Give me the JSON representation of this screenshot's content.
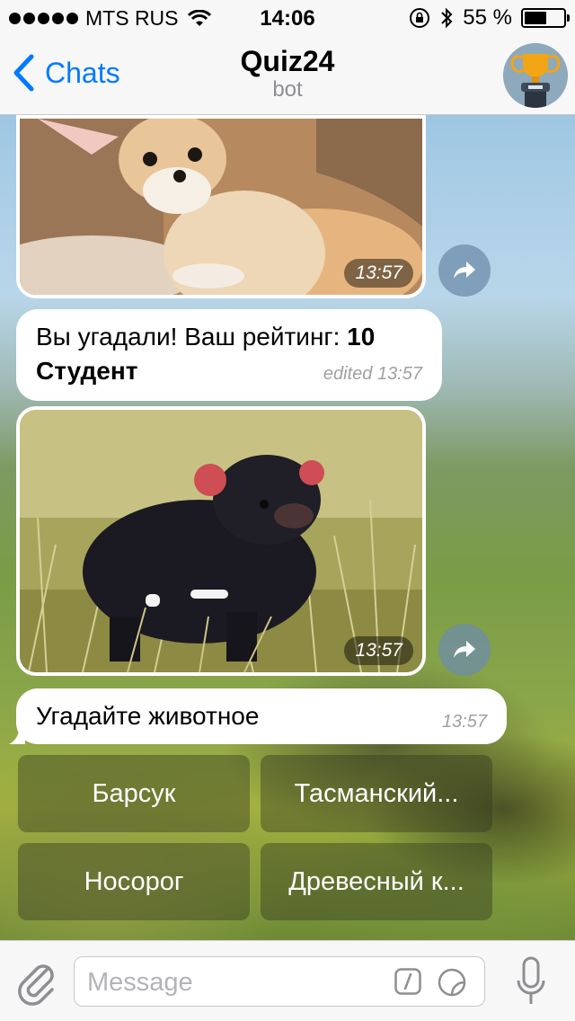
{
  "status_bar": {
    "carrier": "MTS RUS",
    "time": "14:06",
    "battery": "55 %",
    "battery_level": 0.55
  },
  "nav": {
    "back_label": "Chats",
    "title": "Quiz24",
    "subtitle": "bot"
  },
  "messages": {
    "photo1": {
      "time": "13:57"
    },
    "text1": {
      "line1_text": "Вы угадали! Ваш рейтинг: ",
      "line1_value": "10",
      "line2": "Студент",
      "time": "edited 13:57"
    },
    "photo2": {
      "time": "13:57"
    },
    "text2": {
      "text": "Угадайте животное",
      "time": "13:57"
    }
  },
  "keyboard": {
    "buttons": [
      "Барсук",
      "Тасманский...",
      "Носорог",
      "Древесный к..."
    ]
  },
  "input": {
    "placeholder": "Message"
  },
  "colors": {
    "accent": "#007aff",
    "bar_background": "#f7f7f7"
  },
  "icons": [
    "wifi-icon",
    "lock-rotation-icon",
    "bluetooth-icon",
    "battery-icon",
    "back-chevron-icon",
    "trophy-avatar-icon",
    "forward-icon",
    "paperclip-icon",
    "command-icon",
    "sticker-icon",
    "microphone-icon"
  ]
}
